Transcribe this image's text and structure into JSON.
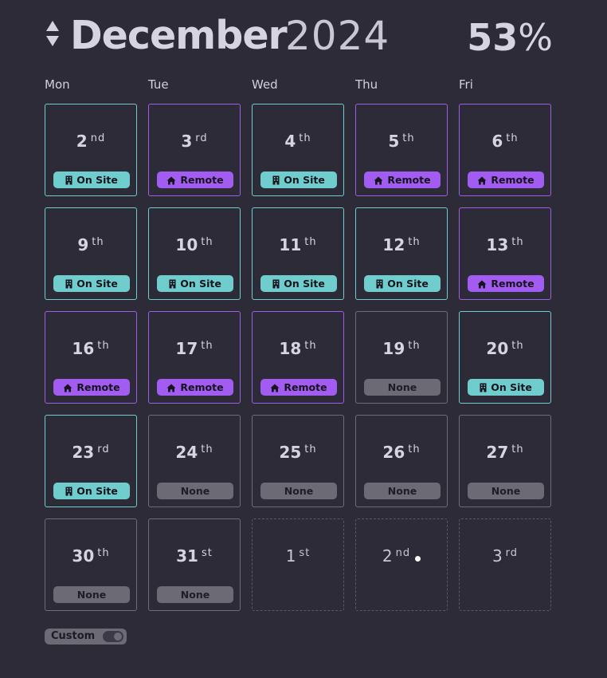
{
  "header": {
    "month": "December",
    "year": "2024",
    "percent_value": "53",
    "percent_symbol": "%"
  },
  "weekdays": [
    "Mon",
    "Tue",
    "Wed",
    "Thu",
    "Fri"
  ],
  "badges": {
    "onsite": "On Site",
    "remote": "Remote",
    "none": "None"
  },
  "colors": {
    "onsite": "#6fcdcd",
    "remote": "#a35cf2",
    "none": "#6b6a75",
    "background": "#2d2b38"
  },
  "icons": {
    "onsite": "building-icon",
    "remote": "home-icon",
    "sort": "sort-arrows-icon",
    "today": "today-dot-icon"
  },
  "days": [
    {
      "day": "2",
      "suffix": "nd",
      "status": "onsite"
    },
    {
      "day": "3",
      "suffix": "rd",
      "status": "remote"
    },
    {
      "day": "4",
      "suffix": "th",
      "status": "onsite"
    },
    {
      "day": "5",
      "suffix": "th",
      "status": "remote"
    },
    {
      "day": "6",
      "suffix": "th",
      "status": "remote"
    },
    {
      "day": "9",
      "suffix": "th",
      "status": "onsite"
    },
    {
      "day": "10",
      "suffix": "th",
      "status": "onsite"
    },
    {
      "day": "11",
      "suffix": "th",
      "status": "onsite"
    },
    {
      "day": "12",
      "suffix": "th",
      "status": "onsite"
    },
    {
      "day": "13",
      "suffix": "th",
      "status": "remote"
    },
    {
      "day": "16",
      "suffix": "th",
      "status": "remote"
    },
    {
      "day": "17",
      "suffix": "th",
      "status": "remote"
    },
    {
      "day": "18",
      "suffix": "th",
      "status": "remote"
    },
    {
      "day": "19",
      "suffix": "th",
      "status": "none"
    },
    {
      "day": "20",
      "suffix": "th",
      "status": "onsite"
    },
    {
      "day": "23",
      "suffix": "rd",
      "status": "onsite"
    },
    {
      "day": "24",
      "suffix": "th",
      "status": "none"
    },
    {
      "day": "25",
      "suffix": "th",
      "status": "none"
    },
    {
      "day": "26",
      "suffix": "th",
      "status": "none"
    },
    {
      "day": "27",
      "suffix": "th",
      "status": "none"
    },
    {
      "day": "30",
      "suffix": "th",
      "status": "none"
    },
    {
      "day": "31",
      "suffix": "st",
      "status": "none"
    },
    {
      "day": "1",
      "suffix": "st",
      "status": "outside"
    },
    {
      "day": "2",
      "suffix": "nd",
      "status": "outside",
      "today": true
    },
    {
      "day": "3",
      "suffix": "rd",
      "status": "outside"
    }
  ],
  "toggle": {
    "label": "Custom",
    "enabled": true
  }
}
